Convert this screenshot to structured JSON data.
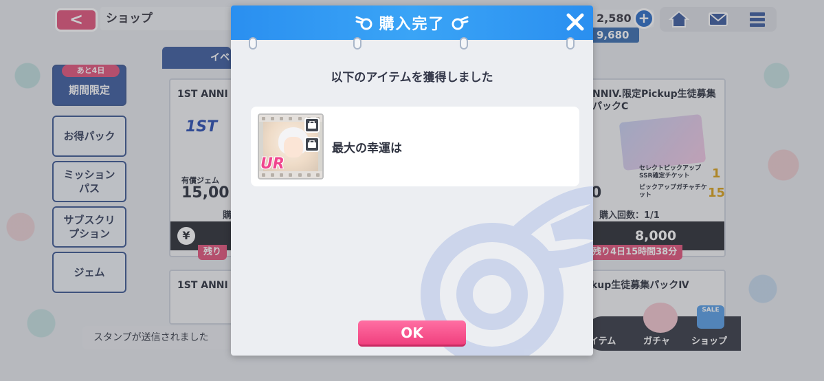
{
  "header": {
    "back_label": "<",
    "title": "ショップ",
    "currency_primary": "2,580",
    "currency_secondary": "9,680",
    "plus_label": "+"
  },
  "sidebar": {
    "limit_badge": "あと4日",
    "items": [
      {
        "label": "期間限定"
      },
      {
        "label": "お得パック"
      },
      {
        "label": "ミッションパス"
      },
      {
        "label": "サブスクリプション"
      },
      {
        "label": "ジェム"
      }
    ]
  },
  "tabs": {
    "first_label": "イベ"
  },
  "cards": [
    {
      "title": "1ST ANNI",
      "gem_label": "有償ジェム",
      "gem_value": "15,00",
      "count_text": "購",
      "remain": "残り"
    },
    {
      "title": "NNIV.限定Pickup生徒募集パックC",
      "gem_value": "0",
      "ticket1": "セレクトピックアップSSR確定チケット",
      "ticket1_num": "1",
      "ticket2": "ピックアップガチャチケット",
      "ticket2_num": "15",
      "count_text": "購入回数：1/1",
      "price": "8,000",
      "remain": "残り4日15時間38分"
    },
    {
      "title": "1ST ANNI"
    },
    {
      "title": "kup生徒募集パックⅣ"
    }
  ],
  "chat": {
    "message": "スタンプが送信されました"
  },
  "bottom_nav": {
    "items": [
      {
        "label": "イテム"
      },
      {
        "label": "ガチャ"
      },
      {
        "label": "ショップ"
      }
    ],
    "sale_label": "SALE"
  },
  "modal": {
    "title": "購入完了",
    "close_label": "✕",
    "message": "以下のアイテムを獲得しました",
    "item": {
      "name": "最大の幸運は",
      "rarity": "UR"
    },
    "ok_label": "OK"
  },
  "colors": {
    "header_blue": "#2a8ff0",
    "accent_pink": "#f0407e",
    "dark_bar": "#2e3138"
  }
}
